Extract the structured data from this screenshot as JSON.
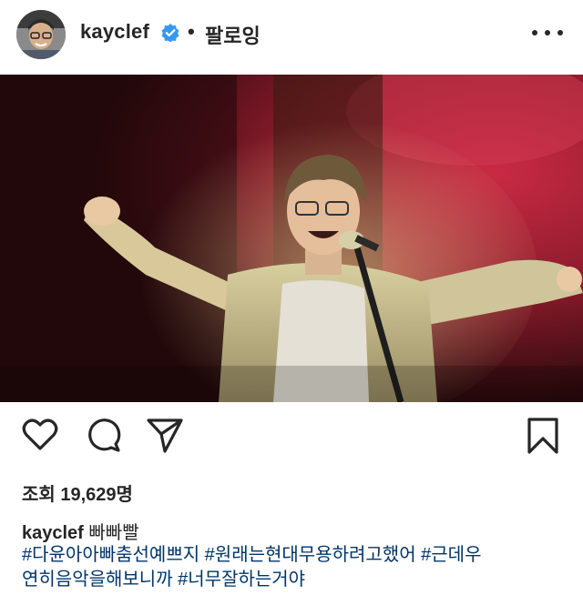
{
  "header": {
    "username": "kayclef",
    "separator": "•",
    "follow_label": "팔로잉",
    "verified_color": "#3897f0"
  },
  "icons": {
    "like": "heart-icon",
    "comment": "comment-icon",
    "share": "send-icon",
    "save": "bookmark-icon",
    "more": "more-options-icon"
  },
  "post": {
    "views_label": "조회 19,629명",
    "caption_user": "kayclef",
    "caption_text": "빠빠빨",
    "hashtags_line1": "#다윤아아빠춤선예쁘지 #원래는현대무용하려고했어 #근데우",
    "hashtags_line2": "연히음악을해보니까 #너무잘하는거야"
  },
  "colors": {
    "text": "#262626",
    "hashtag": "#003569",
    "stage_red": "#b8243a"
  }
}
